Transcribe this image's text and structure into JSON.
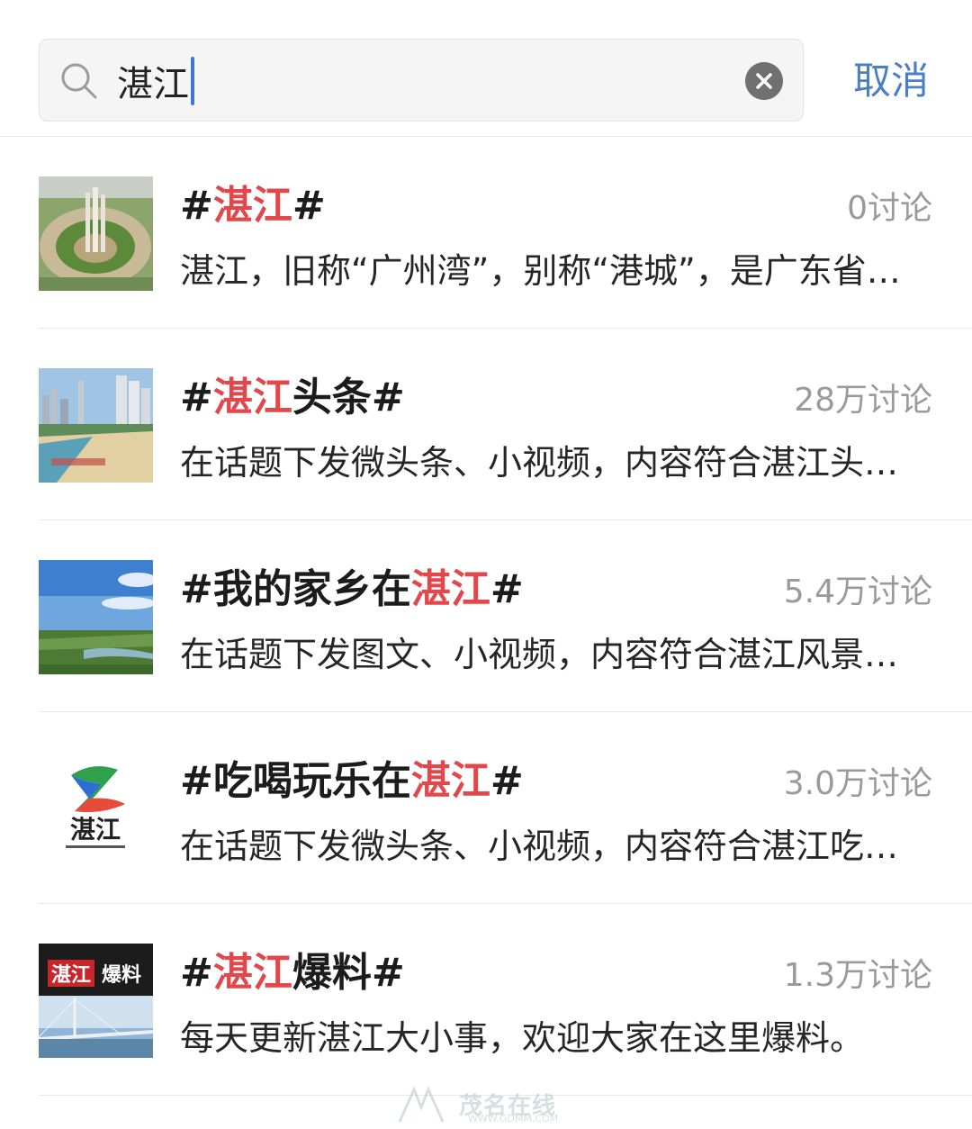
{
  "search": {
    "query": "湛江",
    "cancel_label": "取消"
  },
  "results": [
    {
      "title_prefix": "#",
      "title_highlight": "湛江",
      "title_suffix": "#",
      "count": "0讨论",
      "description": "湛江，旧称“广州湾”，别称“港城”，是广东省地级市",
      "thumbnail": "city-square-monument-image"
    },
    {
      "title_prefix": "#",
      "title_highlight": "湛江",
      "title_suffix": "头条#",
      "count": "28万讨论",
      "description": "在话题下发微头条、小视频，内容符合湛江头条话题",
      "thumbnail": "coastal-city-beach-image"
    },
    {
      "title_prefix": "#我的家乡在",
      "title_highlight": "湛江",
      "title_suffix": "#",
      "count": "5.4万讨论",
      "description": "在话题下发图文、小视频，内容符合湛江风景话题",
      "thumbnail": "green-landscape-blue-sky-image"
    },
    {
      "title_prefix": "#吃喝玩乐在",
      "title_highlight": "湛江",
      "title_suffix": "#",
      "count": "3.0万讨论",
      "description": "在话题下发微头条、小视频，内容符合湛江吃喝玩乐话题",
      "thumbnail": "zhanjiang-media-logo"
    },
    {
      "title_prefix": "#",
      "title_highlight": "湛江",
      "title_suffix": "爆料#",
      "count": "1.3万讨论",
      "description": "每天更新湛江大小事，欢迎大家在这里爆料。",
      "thumbnail": "bridge-news-banner-image"
    }
  ],
  "logo_texts": {
    "logo4_text": "湛江",
    "logo5_text_a": "湛江",
    "logo5_text_b": "爆料"
  },
  "watermark": {
    "text": "茂名在线",
    "url": "WWW.GDMM.COM"
  },
  "colors": {
    "highlight": "#e2474b",
    "accent": "#4a7fc4",
    "count": "#9a9a9a"
  }
}
